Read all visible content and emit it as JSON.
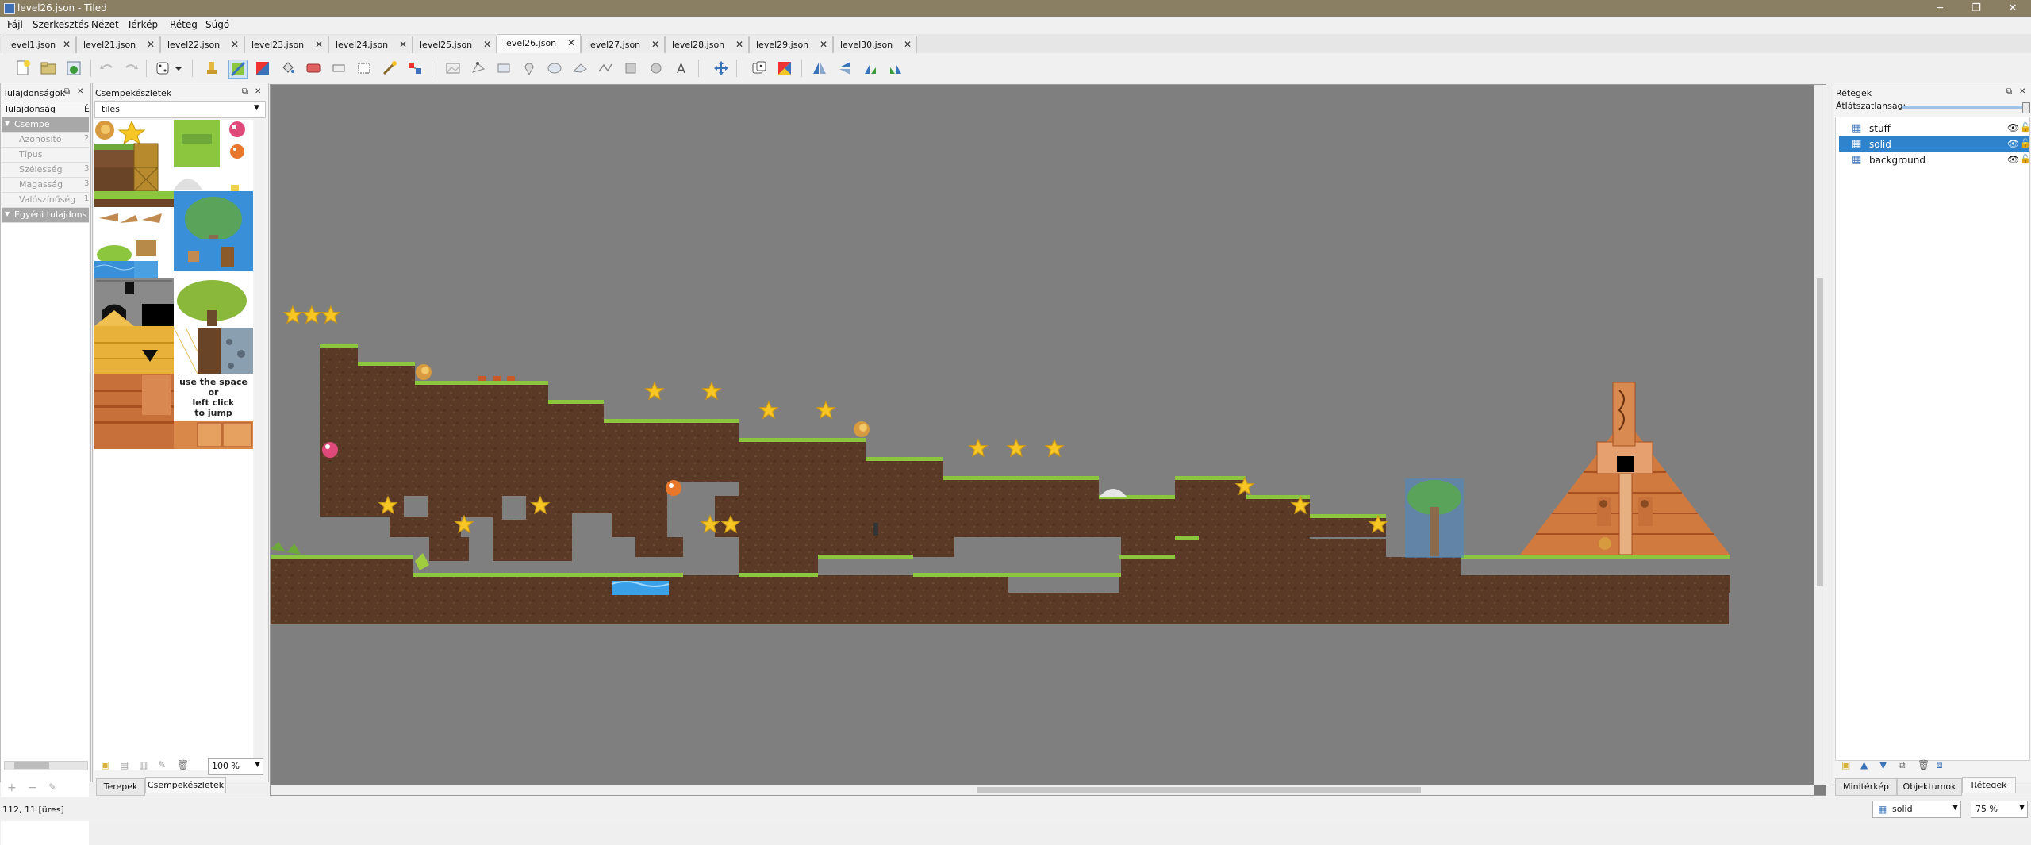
{
  "window": {
    "title": "level26.json - Tiled",
    "minimize": "─",
    "maximize": "❐",
    "close": "✕"
  },
  "menu": [
    "Fájl",
    "Szerkesztés",
    "Nézet",
    "Térkép",
    "Réteg",
    "Súgó"
  ],
  "tabs": [
    {
      "label": "level1.json"
    },
    {
      "label": "level21.json"
    },
    {
      "label": "level22.json"
    },
    {
      "label": "level23.json"
    },
    {
      "label": "level24.json"
    },
    {
      "label": "level25.json"
    },
    {
      "label": "level26.json",
      "active": true
    },
    {
      "label": "level27.json"
    },
    {
      "label": "level28.json"
    },
    {
      "label": "level29.json"
    },
    {
      "label": "level30.json"
    }
  ],
  "properties": {
    "title": "Tulajdonságok",
    "header": "Tulajdonság",
    "header_value": "É",
    "group": "Csempe",
    "rows": [
      {
        "key": "Azonosító",
        "value": "2"
      },
      {
        "key": "Típus",
        "value": ""
      },
      {
        "key": "Szélesség",
        "value": "3"
      },
      {
        "key": "Magasság",
        "value": "3"
      },
      {
        "key": "Valószínűség",
        "value": "1"
      }
    ],
    "custom_group": "Egyéni tulajdons"
  },
  "tilesets": {
    "title": "Csempekészletek",
    "selected": "tiles",
    "zoom": "100 %",
    "hint_text": [
      "use the space",
      "or",
      "left click",
      "to jump"
    ],
    "bottom_tabs": [
      "Terepek",
      "Csempekészletek"
    ]
  },
  "layers": {
    "title": "Rétegek",
    "opacity_label": "Átlátszatlanság:",
    "items": [
      {
        "name": "stuff",
        "selected": false
      },
      {
        "name": "solid",
        "selected": true
      },
      {
        "name": "background",
        "selected": false
      }
    ],
    "bottom_tabs": [
      "Minitérkép",
      "Objektumok",
      "Rétegek"
    ]
  },
  "status": {
    "coords": "112, 11 [üres]",
    "layer": "solid",
    "zoom": "75 %"
  },
  "icons": {
    "eye": "eye-icon",
    "lock": "lock-icon",
    "tilelayer": "tile-layer-icon"
  },
  "colors": {
    "selection": "#2f83cc",
    "canvas": "#7f7f7f",
    "dirt": "#5a3a26",
    "grass": "#8cc63f",
    "star": "#f6c624",
    "water": "#3aa1e8",
    "titlebar": "#8a7e63"
  }
}
